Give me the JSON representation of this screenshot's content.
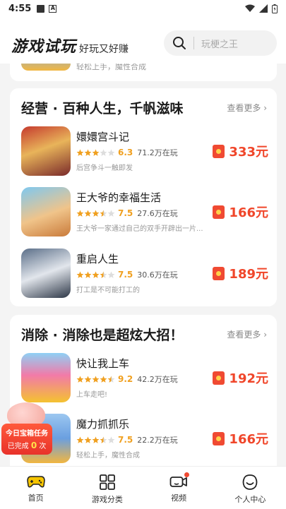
{
  "status_bar": {
    "time": "4:55"
  },
  "header": {
    "brand": "游戏试玩",
    "slogan": "好玩又好赚",
    "search_placeholder": "玩梗之王"
  },
  "partial_item": {
    "desc": "轻松上手，魔性合成"
  },
  "sections": [
    {
      "title": "经营 · 百种人生，千帆滋味",
      "more": "查看更多 ›",
      "games": [
        {
          "name": "嬛嬛宫斗记",
          "rating": "6.3",
          "stars": 3,
          "players": "71.2万在玩",
          "desc": "后宫争斗一触即发",
          "reward": "333元"
        },
        {
          "name": "王大爷的幸福生活",
          "rating": "7.5",
          "stars": 3.5,
          "players": "27.6万在玩",
          "desc": "王大爷一家通过自己的双手开辟出一片...",
          "reward": "166元"
        },
        {
          "name": "重启人生",
          "rating": "7.5",
          "stars": 3.5,
          "players": "30.6万在玩",
          "desc": "打工是不可能打工的",
          "reward": "189元"
        }
      ]
    },
    {
      "title": "消除 · 消除也是超炫大招！",
      "more": "查看更多 ›",
      "games": [
        {
          "name": "快让我上车",
          "rating": "9.2",
          "stars": 4.5,
          "players": "42.2万在玩",
          "desc": "上车走吧!",
          "reward": "192元"
        },
        {
          "name": "魔力抓抓乐",
          "rating": "7.5",
          "stars": 3.5,
          "players": "22.2万在玩",
          "desc": "轻松上手，魔性合成",
          "reward": "166元"
        }
      ]
    }
  ],
  "floating_task": {
    "title": "今日宝箱任务",
    "status_prefix": "已完成",
    "count": "0",
    "status_suffix": "次"
  },
  "tabbar": [
    {
      "label": "首页",
      "icon": "gamepad-icon",
      "active": true
    },
    {
      "label": "游戏分类",
      "icon": "grid-icon"
    },
    {
      "label": "视频",
      "icon": "video-icon",
      "dot": true
    },
    {
      "label": "个人中心",
      "icon": "smile-icon"
    }
  ],
  "colors": {
    "accent": "#f0462a",
    "star": "#f0a020",
    "tab_active": "#f5c400"
  }
}
